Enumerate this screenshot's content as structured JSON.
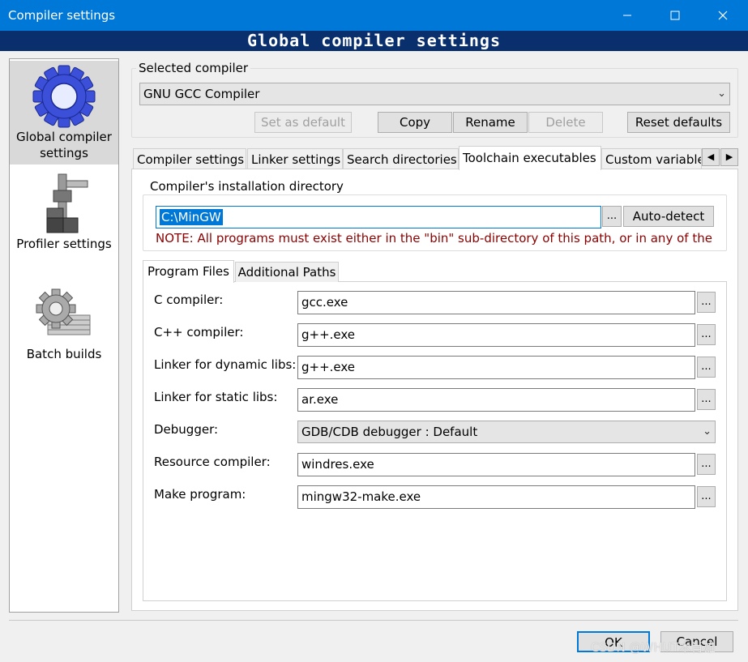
{
  "window": {
    "title": "Compiler settings"
  },
  "banner": {
    "title": "Global compiler settings"
  },
  "sidebar": {
    "items": [
      {
        "line1": "Global compiler",
        "line2": "settings",
        "icon": "gear-icon"
      },
      {
        "label": "Profiler settings",
        "icon": "caliper-icon"
      },
      {
        "label": "Batch builds",
        "icon": "batch-gear-icon"
      }
    ]
  },
  "selected_compiler": {
    "group_label": "Selected compiler",
    "value": "GNU GCC Compiler"
  },
  "toolbar": {
    "set_default": "Set as default",
    "copy": "Copy",
    "rename": "Rename",
    "delete": "Delete",
    "reset": "Reset defaults"
  },
  "tabs": [
    "Compiler settings",
    "Linker settings",
    "Search directories",
    "Toolchain executables",
    "Custom variable"
  ],
  "install_dir": {
    "group_label": "Compiler's installation directory",
    "value": "C:\\MinGW",
    "browse": "...",
    "autodetect": "Auto-detect",
    "note": "NOTE: All programs must exist either in the \"bin\" sub-directory of this path, or in any of the"
  },
  "subtabs": [
    "Program Files",
    "Additional Paths"
  ],
  "programs": [
    {
      "label": "C compiler:",
      "value": "gcc.exe",
      "type": "text"
    },
    {
      "label": "C++ compiler:",
      "value": "g++.exe",
      "type": "text"
    },
    {
      "label": "Linker for dynamic libs:",
      "value": "g++.exe",
      "type": "text"
    },
    {
      "label": "Linker for static libs:",
      "value": "ar.exe",
      "type": "text"
    },
    {
      "label": "Debugger:",
      "value": "GDB/CDB debugger : Default",
      "type": "select"
    },
    {
      "label": "Resource compiler:",
      "value": "windres.exe",
      "type": "text"
    },
    {
      "label": "Make program:",
      "value": "mingw32-make.exe",
      "type": "text"
    }
  ],
  "browse_label": "...",
  "footer": {
    "ok": "OK",
    "cancel": "Cancel",
    "watermark": "CSDN @WHUT木肖雄"
  }
}
